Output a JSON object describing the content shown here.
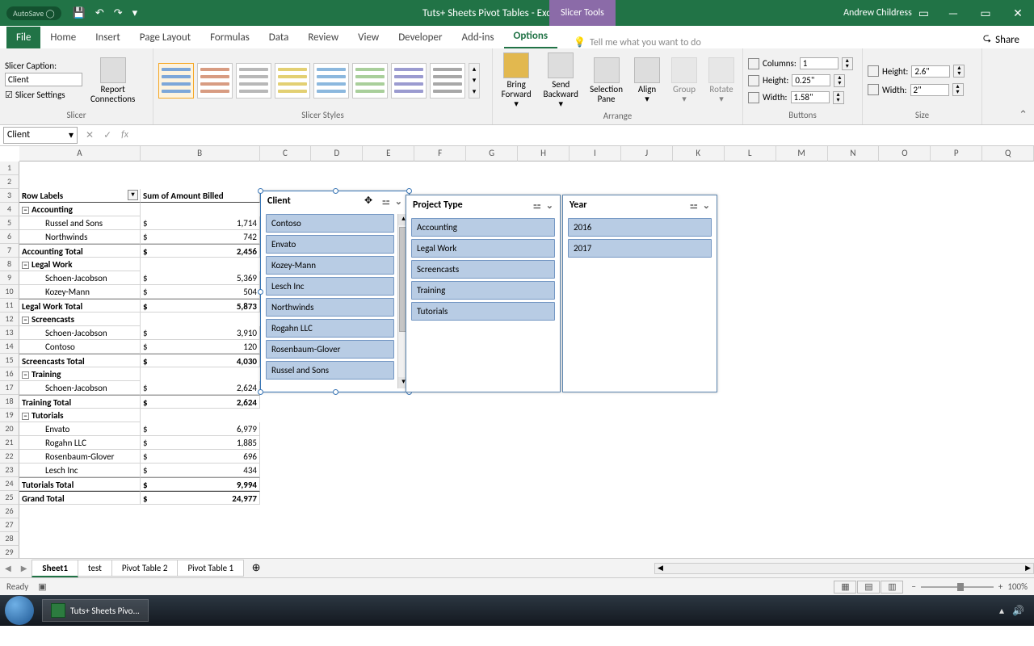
{
  "titlebar": {
    "autosave": "AutoSave ◯",
    "title": "Tuts+ Sheets Pivot Tables - Excel",
    "context_tab": "Slicer Tools",
    "user": "Andrew Childress"
  },
  "menu": {
    "file": "File",
    "home": "Home",
    "insert": "Insert",
    "page_layout": "Page Layout",
    "formulas": "Formulas",
    "data": "Data",
    "review": "Review",
    "view": "View",
    "developer": "Developer",
    "addins": "Add-ins",
    "options": "Options",
    "tell_me": "Tell me what you want to do",
    "share": "Share"
  },
  "ribbon": {
    "slicer_caption_label": "Slicer Caption:",
    "slicer_caption_value": "Client",
    "slicer_settings": "Slicer Settings",
    "report_connections": "Report\nConnections",
    "bring_forward": "Bring\nForward ▾",
    "send_backward": "Send\nBackward ▾",
    "selection_pane": "Selection\nPane",
    "align": "Align\n▾",
    "group": "Group\n▾",
    "rotate": "Rotate\n▾",
    "columns_label": "Columns:",
    "columns_val": "1",
    "btn_height_label": "Height:",
    "btn_height_val": "0.25\"",
    "btn_width_label": "Width:",
    "btn_width_val": "1.58\"",
    "sz_height_label": "Height:",
    "sz_height_val": "2.6\"",
    "sz_width_label": "Width:",
    "sz_width_val": "2\"",
    "groups": {
      "slicer": "Slicer",
      "styles": "Slicer Styles",
      "arrange": "Arrange",
      "buttons": "Buttons",
      "size": "Size"
    }
  },
  "namebox": "Client",
  "cols": [
    "A",
    "B",
    "C",
    "D",
    "E",
    "F",
    "G",
    "H",
    "I",
    "J",
    "K",
    "L",
    "M",
    "N",
    "O",
    "P",
    "Q"
  ],
  "pivot": {
    "headers": {
      "row_labels": "Row Labels",
      "sum": "Sum of Amount Billed"
    },
    "rows": [
      {
        "t": "group",
        "label": "Accounting"
      },
      {
        "t": "item",
        "label": "Russel and Sons",
        "cur": "$",
        "val": "1,714"
      },
      {
        "t": "item",
        "label": "Northwinds",
        "cur": "$",
        "val": "742"
      },
      {
        "t": "total",
        "label": "Accounting Total",
        "cur": "$",
        "val": "2,456"
      },
      {
        "t": "group",
        "label": "Legal Work"
      },
      {
        "t": "item",
        "label": "Schoen-Jacobson",
        "cur": "$",
        "val": "5,369"
      },
      {
        "t": "item",
        "label": "Kozey-Mann",
        "cur": "$",
        "val": "504"
      },
      {
        "t": "total",
        "label": "Legal Work Total",
        "cur": "$",
        "val": "5,873"
      },
      {
        "t": "group",
        "label": "Screencasts"
      },
      {
        "t": "item",
        "label": "Schoen-Jacobson",
        "cur": "$",
        "val": "3,910"
      },
      {
        "t": "item",
        "label": "Contoso",
        "cur": "$",
        "val": "120"
      },
      {
        "t": "total",
        "label": "Screencasts Total",
        "cur": "$",
        "val": "4,030"
      },
      {
        "t": "group",
        "label": "Training"
      },
      {
        "t": "item",
        "label": "Schoen-Jacobson",
        "cur": "$",
        "val": "2,624"
      },
      {
        "t": "total",
        "label": "Training Total",
        "cur": "$",
        "val": "2,624"
      },
      {
        "t": "group",
        "label": "Tutorials"
      },
      {
        "t": "item",
        "label": "Envato",
        "cur": "$",
        "val": "6,979"
      },
      {
        "t": "item",
        "label": "Rogahn LLC",
        "cur": "$",
        "val": "1,885"
      },
      {
        "t": "item",
        "label": "Rosenbaum-Glover",
        "cur": "$",
        "val": "696"
      },
      {
        "t": "item",
        "label": "Lesch Inc",
        "cur": "$",
        "val": "434"
      },
      {
        "t": "total",
        "label": "Tutorials Total",
        "cur": "$",
        "val": "9,994"
      },
      {
        "t": "grand",
        "label": "Grand Total",
        "cur": "$",
        "val": "24,977"
      }
    ]
  },
  "slicers": {
    "client": {
      "title": "Client",
      "items": [
        "Contoso",
        "Envato",
        "Kozey-Mann",
        "Lesch Inc",
        "Northwinds",
        "Rogahn LLC",
        "Rosenbaum-Glover",
        "Russel and Sons"
      ]
    },
    "project": {
      "title": "Project Type",
      "items": [
        "Accounting",
        "Legal Work",
        "Screencasts",
        "Training",
        "Tutorials"
      ]
    },
    "year": {
      "title": "Year",
      "items": [
        "2016",
        "2017"
      ]
    }
  },
  "sheets": {
    "s1": "Sheet1",
    "s2": "test",
    "s3": "Pivot Table 2",
    "s4": "Pivot Table 1"
  },
  "status": {
    "ready": "Ready",
    "zoom": "100%"
  },
  "taskbar": {
    "app": "Tuts+ Sheets Pivo..."
  }
}
